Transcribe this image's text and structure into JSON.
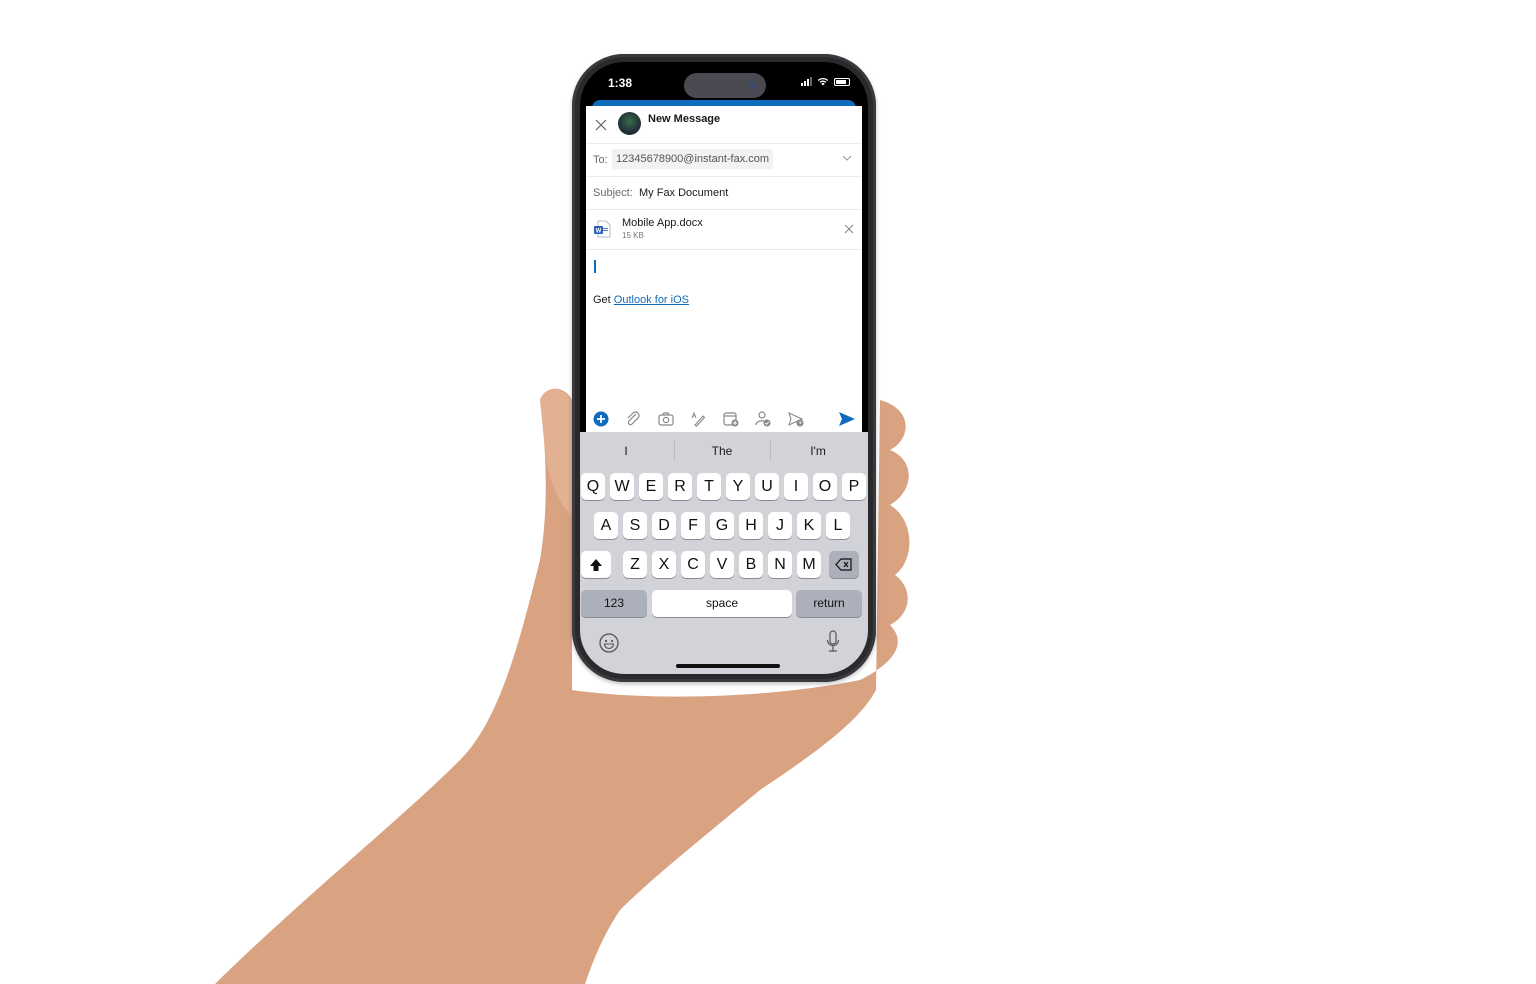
{
  "status_bar": {
    "time": "1:38"
  },
  "compose": {
    "title": "New Message",
    "to_label": "To:",
    "to_value": "12345678900@instant-fax.com",
    "subject_label": "Subject:",
    "subject_value": "My Fax Document",
    "attachment": {
      "name": "Mobile App.docx",
      "size": "15 KB"
    },
    "signature_prefix": "Get",
    "signature_link": "Outlook for iOS"
  },
  "toolbar": {
    "icons": [
      "add-icon",
      "attach-icon",
      "camera-icon",
      "draw-icon",
      "calendar-add-icon",
      "availability-icon",
      "schedule-send-icon",
      "send-icon"
    ]
  },
  "keyboard": {
    "suggestions": [
      "I",
      "The",
      "I'm"
    ],
    "row1": [
      "Q",
      "W",
      "E",
      "R",
      "T",
      "Y",
      "U",
      "I",
      "O",
      "P"
    ],
    "row2": [
      "A",
      "S",
      "D",
      "F",
      "G",
      "H",
      "J",
      "K",
      "L"
    ],
    "row3": [
      "Z",
      "X",
      "C",
      "V",
      "B",
      "N",
      "M"
    ],
    "numbers_label": "123",
    "space_label": "space",
    "return_label": "return"
  },
  "colors": {
    "accent": "#0f6cbd",
    "keyboard_bg": "#d1d3d9"
  }
}
